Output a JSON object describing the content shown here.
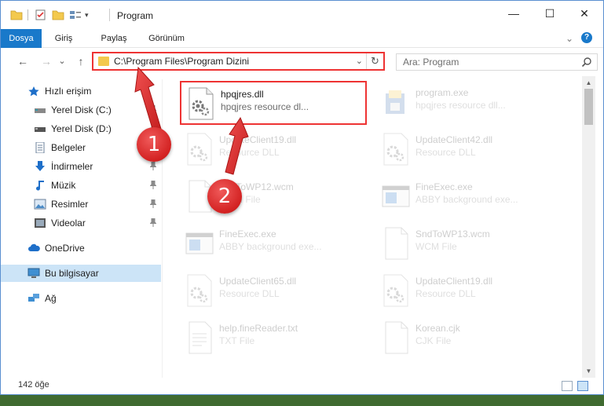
{
  "window": {
    "title": "Program",
    "controls": {
      "minimize": "—",
      "maximize": "☐",
      "close": "✕"
    }
  },
  "ribbon": {
    "tabs": [
      "Dosya",
      "Giriş",
      "Paylaş",
      "Görünüm"
    ],
    "help": "?",
    "collapse": "⌄"
  },
  "navbar": {
    "back": "←",
    "forward": "→",
    "recent": "⌄",
    "up": "↑",
    "address": "C:\\Program Files\\Program Dizini",
    "address_dropdown": "⌄",
    "refresh": "↻",
    "search_placeholder": "Ara: Program"
  },
  "sidebar": {
    "items": [
      {
        "label": "Hızlı erişim",
        "icon": "star-icon",
        "pinned": false
      },
      {
        "label": "Yerel Disk (C:)",
        "icon": "drive-icon",
        "pinned": true
      },
      {
        "label": "Yerel Disk (D:)",
        "icon": "drive-icon",
        "pinned": true
      },
      {
        "label": "Belgeler",
        "icon": "documents-icon",
        "pinned": true
      },
      {
        "label": "İndirmeler",
        "icon": "download-icon",
        "pinned": true
      },
      {
        "label": "Müzik",
        "icon": "music-icon",
        "pinned": true
      },
      {
        "label": "Resimler",
        "icon": "pictures-icon",
        "pinned": true
      },
      {
        "label": "Videolar",
        "icon": "videos-icon",
        "pinned": true
      },
      {
        "label": "OneDrive",
        "icon": "cloud-icon",
        "pinned": false
      },
      {
        "label": "Bu bilgisayar",
        "icon": "computer-icon",
        "pinned": false
      },
      {
        "label": "Ağ",
        "icon": "network-icon",
        "pinned": false
      }
    ]
  },
  "files": [
    {
      "name": "hpqjres.dll",
      "desc": "hpqjres resource dl...",
      "icon": "dll-gear-icon",
      "highlighted": true
    },
    {
      "name": "program.exe",
      "desc": "hpqjres resource dll...",
      "icon": "installer-icon",
      "highlighted": false
    },
    {
      "name": "UpdateClient19.dll",
      "desc": "Resource DLL",
      "icon": "dll-gear-icon",
      "highlighted": false
    },
    {
      "name": "UpdateClient42.dll",
      "desc": "Resource DLL",
      "icon": "dll-gear-icon",
      "highlighted": false
    },
    {
      "name": "SndToWP12.wcm",
      "desc": "WCM File",
      "icon": "blank-file-icon",
      "highlighted": false
    },
    {
      "name": "FineExec.exe",
      "desc": "ABBY background exe...",
      "icon": "app-window-icon",
      "highlighted": false
    },
    {
      "name": "FineExec.exe",
      "desc": "ABBY background exe...",
      "icon": "app-window-icon",
      "highlighted": false
    },
    {
      "name": "SndToWP13.wcm",
      "desc": "WCM File",
      "icon": "blank-file-icon",
      "highlighted": false
    },
    {
      "name": "UpdateClient65.dll",
      "desc": "Resource DLL",
      "icon": "dll-gear-icon",
      "highlighted": false
    },
    {
      "name": "UpdateClient19.dll",
      "desc": "Resource DLL",
      "icon": "dll-gear-icon",
      "highlighted": false
    },
    {
      "name": "help.fineReader.txt",
      "desc": "TXT File",
      "icon": "text-file-icon",
      "highlighted": false
    },
    {
      "name": "Korean.cjk",
      "desc": "CJK File",
      "icon": "blank-file-icon",
      "highlighted": false
    }
  ],
  "status": {
    "item_count": "142 öğe"
  },
  "callouts": [
    "1",
    "2"
  ],
  "colors": {
    "accent": "#1979ca",
    "highlight": "#e33333",
    "selected": "#cce4f7"
  }
}
